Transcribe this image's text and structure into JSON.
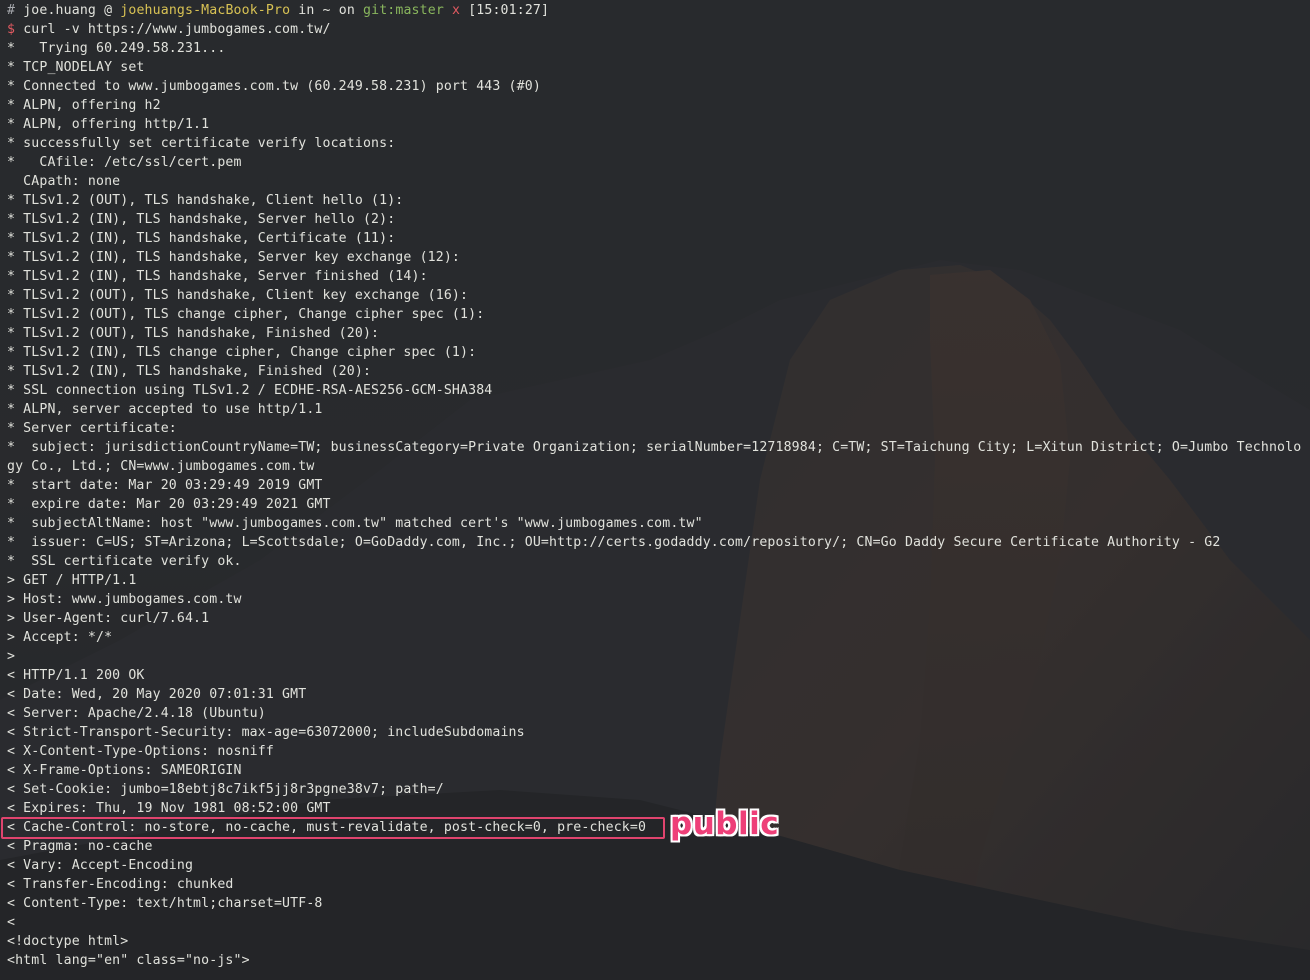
{
  "prompt": {
    "hash": "#",
    "user": "joe.huang",
    "at": "@",
    "host": "joehuangs-MacBook-Pro",
    "in": "in",
    "dir": "~",
    "on": "on",
    "git": "git:master",
    "dirty": "x",
    "time": "[15:01:27]"
  },
  "command": {
    "dollar": "$",
    "text": "curl -v https://www.jumbogames.com.tw/"
  },
  "output": [
    "*   Trying 60.249.58.231...",
    "* TCP_NODELAY set",
    "* Connected to www.jumbogames.com.tw (60.249.58.231) port 443 (#0)",
    "* ALPN, offering h2",
    "* ALPN, offering http/1.1",
    "* successfully set certificate verify locations:",
    "*   CAfile: /etc/ssl/cert.pem",
    "  CApath: none",
    "* TLSv1.2 (OUT), TLS handshake, Client hello (1):",
    "* TLSv1.2 (IN), TLS handshake, Server hello (2):",
    "* TLSv1.2 (IN), TLS handshake, Certificate (11):",
    "* TLSv1.2 (IN), TLS handshake, Server key exchange (12):",
    "* TLSv1.2 (IN), TLS handshake, Server finished (14):",
    "* TLSv1.2 (OUT), TLS handshake, Client key exchange (16):",
    "* TLSv1.2 (OUT), TLS change cipher, Change cipher spec (1):",
    "* TLSv1.2 (OUT), TLS handshake, Finished (20):",
    "* TLSv1.2 (IN), TLS change cipher, Change cipher spec (1):",
    "* TLSv1.2 (IN), TLS handshake, Finished (20):",
    "* SSL connection using TLSv1.2 / ECDHE-RSA-AES256-GCM-SHA384",
    "* ALPN, server accepted to use http/1.1",
    "* Server certificate:",
    "*  subject: jurisdictionCountryName=TW; businessCategory=Private Organization; serialNumber=12718984; C=TW; ST=Taichung City; L=Xitun District; O=Jumbo Technology Co., Ltd.; CN=www.jumbogames.com.tw",
    "*  start date: Mar 20 03:29:49 2019 GMT",
    "*  expire date: Mar 20 03:29:49 2021 GMT",
    "*  subjectAltName: host \"www.jumbogames.com.tw\" matched cert's \"www.jumbogames.com.tw\"",
    "*  issuer: C=US; ST=Arizona; L=Scottsdale; O=GoDaddy.com, Inc.; OU=http://certs.godaddy.com/repository/; CN=Go Daddy Secure Certificate Authority - G2",
    "*  SSL certificate verify ok.",
    "> GET / HTTP/1.1",
    "> Host: www.jumbogames.com.tw",
    "> User-Agent: curl/7.64.1",
    "> Accept: */*",
    ">",
    "< HTTP/1.1 200 OK",
    "< Date: Wed, 20 May 2020 07:01:31 GMT",
    "< Server: Apache/2.4.18 (Ubuntu)",
    "< Strict-Transport-Security: max-age=63072000; includeSubdomains",
    "< X-Content-Type-Options: nosniff",
    "< X-Frame-Options: SAMEORIGIN",
    "< Set-Cookie: jumbo=18ebtj8c7ikf5jj8r3pgne38v7; path=/",
    "< Expires: Thu, 19 Nov 1981 08:52:00 GMT",
    "< Cache-Control: no-store, no-cache, must-revalidate, post-check=0, pre-check=0",
    "< Pragma: no-cache",
    "< Vary: Accept-Encoding",
    "< Transfer-Encoding: chunked",
    "< Content-Type: text/html;charset=UTF-8",
    "<",
    "<!doctype html>",
    "<html lang=\"en\" class=\"no-js\">"
  ],
  "annotation": {
    "text": "public",
    "color": "#ee3f78",
    "box_color": "#e0446e"
  },
  "colors": {
    "text": "#e1e2dc",
    "host": "#d8c254",
    "git": "#89b65d",
    "dirty": "#e25a61",
    "background": "#2b2d32"
  }
}
